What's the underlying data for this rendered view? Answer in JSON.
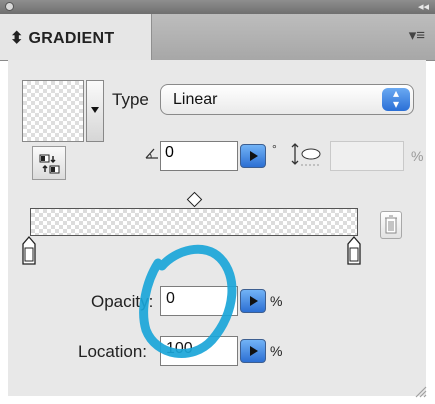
{
  "panel": {
    "collapse_icon": "double-chevron-icon",
    "tab_label": "⬍ GRADIENT",
    "menu_icon": "panel-menu-icon"
  },
  "gradient": {
    "type_label": "Type",
    "type_value": "Linear",
    "type_stepper": "▲▼",
    "angle_value": "0",
    "angle_unit": "°",
    "aspect_unit": "%"
  },
  "stop": {
    "opacity_label": "Opacity:",
    "opacity_value": "0",
    "opacity_unit": "%",
    "location_label": "Location:",
    "location_value": "100",
    "location_unit": "%"
  },
  "annotation": {
    "color": "#1aa5d8"
  },
  "colors": {
    "accent": "#2c6fd3"
  }
}
